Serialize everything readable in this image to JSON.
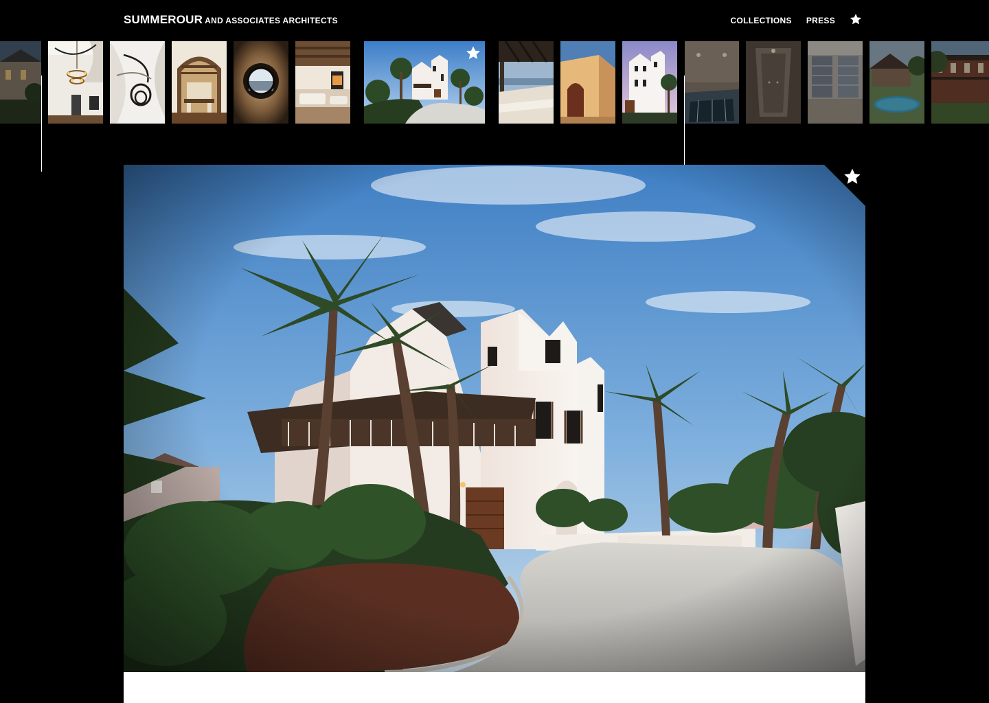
{
  "header": {
    "brand_main": "SUMMEROUR",
    "brand_sub": "AND ASSOCIATES ARCHITECTS",
    "nav": {
      "collections_label": "COLLECTIONS",
      "press_label": "PRESS",
      "favorites_icon": "star-icon"
    }
  },
  "thumbnail_strip": {
    "thumbnails": [
      {
        "subject": "house-exterior-night",
        "dimmed": true
      },
      {
        "subject": "staircase-chandelier",
        "dimmed": false
      },
      {
        "subject": "spiral-staircase",
        "dimmed": false
      },
      {
        "subject": "arched-dining-room",
        "dimmed": false
      },
      {
        "subject": "round-porthole-window",
        "dimmed": false
      },
      {
        "subject": "living-room-beams",
        "dimmed": false
      },
      {
        "subject": "white-beach-house-palms",
        "dimmed": false,
        "selected": true,
        "favorited": true
      },
      {
        "subject": "terrace-pergola",
        "dimmed": false
      },
      {
        "subject": "courtyard-doorway",
        "dimmed": false
      },
      {
        "subject": "white-house-tower",
        "dimmed": false
      },
      {
        "subject": "spa-pool-room",
        "dimmed": true
      },
      {
        "subject": "steam-shower",
        "dimmed": true
      },
      {
        "subject": "wine-cellar",
        "dimmed": true
      },
      {
        "subject": "pool-lawn",
        "dimmed": true
      },
      {
        "subject": "brick-house-porch",
        "dimmed": true
      }
    ]
  },
  "hero": {
    "subject": "white-beach-house-palms",
    "favorite_icon": "star-icon"
  },
  "colors": {
    "background": "#000000",
    "text": "#ffffff",
    "sky_top": "#3f7fc4",
    "sky_bottom": "#bcd6ee",
    "palm_green": "#2f4a2a",
    "stucco": "#f2ece6"
  }
}
